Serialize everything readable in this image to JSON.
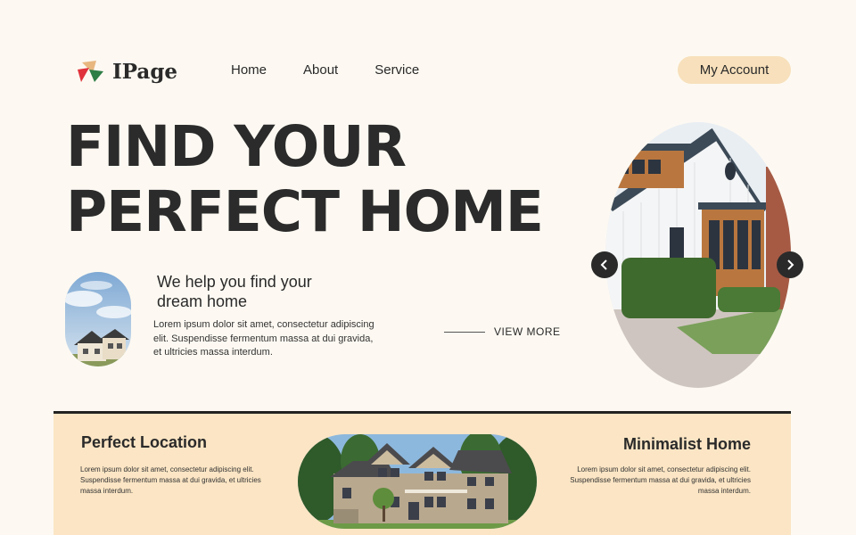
{
  "brand": {
    "name": "IPage",
    "logo_icon": "geometric-logo-icon"
  },
  "nav": {
    "items": [
      {
        "label": "Home"
      },
      {
        "label": "About"
      },
      {
        "label": "Service"
      }
    ]
  },
  "account_button": {
    "label": "My Account"
  },
  "hero": {
    "title_line1": "FIND YOUR",
    "title_line2": "PERFECT HOME",
    "subhead_line1": "We help you find your",
    "subhead_line2": "dream home",
    "text": "Lorem ipsum dolor sit amet, consectetur adipiscing elit. Suspendisse fermentum massa at dui gravida, et ultricies massa interdum.",
    "view_more": "VIEW MORE"
  },
  "carousel": {
    "prev_icon": "chevron-left-icon",
    "next_icon": "chevron-right-icon"
  },
  "features": [
    {
      "title": "Perfect Location",
      "text": "Lorem ipsum dolor sit amet, consectetur adipiscing elit. Suspendisse fermentum massa at dui gravida, et ultricies massa interdum."
    },
    {
      "title": "Minimalist Home",
      "text": "Lorem ipsum dolor sit amet, consectetur adipiscing elit. Suspendisse fermentum massa at dui gravida, et ultricies massa interdum."
    }
  ],
  "colors": {
    "background": "#fdf9f2",
    "accent": "#f7e0bb",
    "band": "#fbe5c4",
    "text": "#2a2a2a"
  }
}
